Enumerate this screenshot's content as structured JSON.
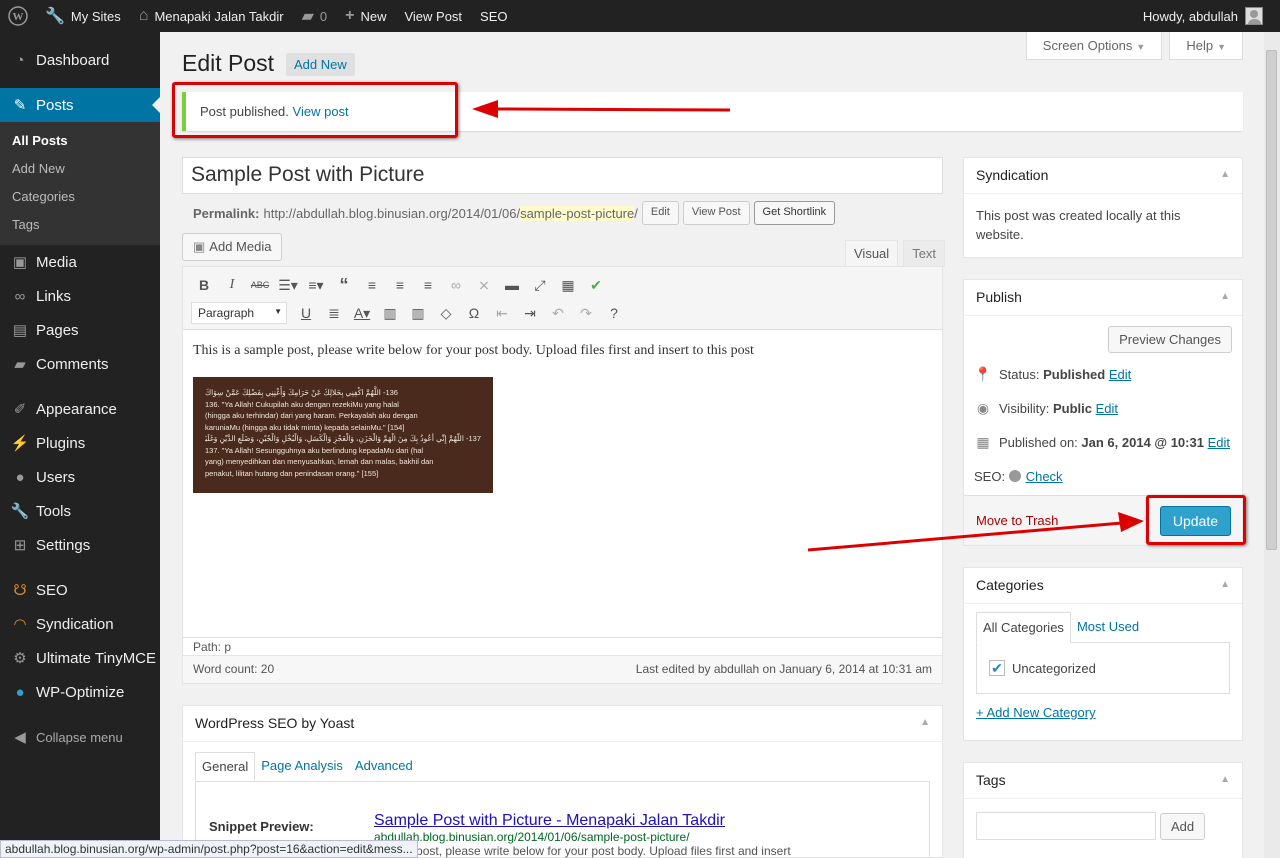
{
  "adminbar": {
    "my_sites": "My Sites",
    "site_name": "Menapaki Jalan Takdir",
    "comments_count": "0",
    "new_label": "New",
    "view_post": "View Post",
    "seo": "SEO",
    "howdy": "Howdy, abdullah"
  },
  "menu": {
    "dashboard": "Dashboard",
    "posts": "Posts",
    "posts_sub": [
      "All Posts",
      "Add New",
      "Categories",
      "Tags"
    ],
    "media": "Media",
    "links": "Links",
    "pages": "Pages",
    "comments": "Comments",
    "appearance": "Appearance",
    "plugins": "Plugins",
    "users": "Users",
    "tools": "Tools",
    "settings": "Settings",
    "seo": "SEO",
    "syndication": "Syndication",
    "ultimate_tinymce": "Ultimate TinyMCE",
    "wp_optimize": "WP-Optimize",
    "collapse": "Collapse menu"
  },
  "screen_tabs": {
    "screen_options": "Screen Options",
    "help": "Help"
  },
  "page": {
    "title": "Edit Post",
    "add_new": "Add New",
    "notice_text": "Post published.",
    "notice_link": "View post"
  },
  "post": {
    "title": "Sample Post with Picture",
    "permalink_label": "Permalink:",
    "permalink_base": "http://abdullah.blog.binusian.org/2014/01/06/",
    "permalink_slug": "sample-post-picture",
    "permalink_end": "/",
    "edit_btn": "Edit",
    "view_post_btn": "View Post",
    "shortlink_btn": "Get Shortlink",
    "add_media": "Add Media",
    "tab_visual": "Visual",
    "tab_text": "Text",
    "format_select": "Paragraph",
    "body": "This is a sample post, please write below for your post body. Upload files first and insert to this post",
    "image_lines": [
      "136- اللَّهُمَّ اكْفِنِي بِحَلالِكَ عَنْ حَرَامِكَ وَأَغْنِنِي بِفَضْلِكَ عَمَّنْ سِوَاكَ",
      "136. \"Ya Allah! Cukupilah aku dengan rezekiMu yang halal",
      "(hingga aku terhindar) dari yang haram. Perkayalah aku dengan",
      "karuniaMu (hingga aku tidak minta) kepada selainMu.\" [154]",
      "137- اللَّهُمَّ إِنِّي أَعُوذُ بِكَ مِنَ الْهَمِّ وَالْحَزَنِ، وَالْعَجْزِ وَالْكَسَلِ، وَالْبُخْلِ وَالْجُبْنِ، وَضَلَعِ الدَّيْنِ وَغَلَبَةِ الرِّجَالِ",
      "137. \"Ya Allah! Sesungguhnya aku berlindung kepadaMu dari (hal",
      "yang) menyedihkan dan menyusahkan, lemah dan malas, bakhil dan",
      "penakut, lilitan hutang dan penindasan orang.\" [155]"
    ],
    "path": "Path: p",
    "word_count": "Word count: 20",
    "last_edited": "Last edited by abdullah on January 6, 2014 at 10:31 am"
  },
  "yoast": {
    "title": "WordPress SEO by Yoast",
    "tabs": [
      "General",
      "Page Analysis",
      "Advanced"
    ],
    "snippet_label": "Snippet Preview:",
    "snippet_title": "Sample Post with Picture - Menapaki Jalan Takdir",
    "snippet_url": "abdullah.blog.binusian.org/2014/01/06/sample-post-picture/",
    "snippet_desc": "sample post, please write below for your post body. Upload files first and insert"
  },
  "syndication": {
    "title": "Syndication",
    "text": "This post was created locally at this website."
  },
  "publish": {
    "title": "Publish",
    "preview": "Preview Changes",
    "status_label": "Status:",
    "status_value": "Published",
    "visibility_label": "Visibility:",
    "visibility_value": "Public",
    "published_label": "Published on:",
    "published_value": "Jan 6, 2014 @ 10:31",
    "edit": "Edit",
    "seo_label": "SEO:",
    "seo_check": "Check",
    "trash": "Move to Trash",
    "update": "Update"
  },
  "categories": {
    "title": "Categories",
    "tab_all": "All Categories",
    "tab_used": "Most Used",
    "item": "Uncategorized",
    "add_new": "+ Add New Category"
  },
  "tags": {
    "title": "Tags",
    "add": "Add"
  },
  "statusbar": "abdullah.blog.binusian.org/wp-admin/post.php?post=16&action=edit&mess...",
  "colors": {
    "accent": "#0074a2",
    "annotation": "#dd0000",
    "update_button": "#2ea2cc"
  }
}
